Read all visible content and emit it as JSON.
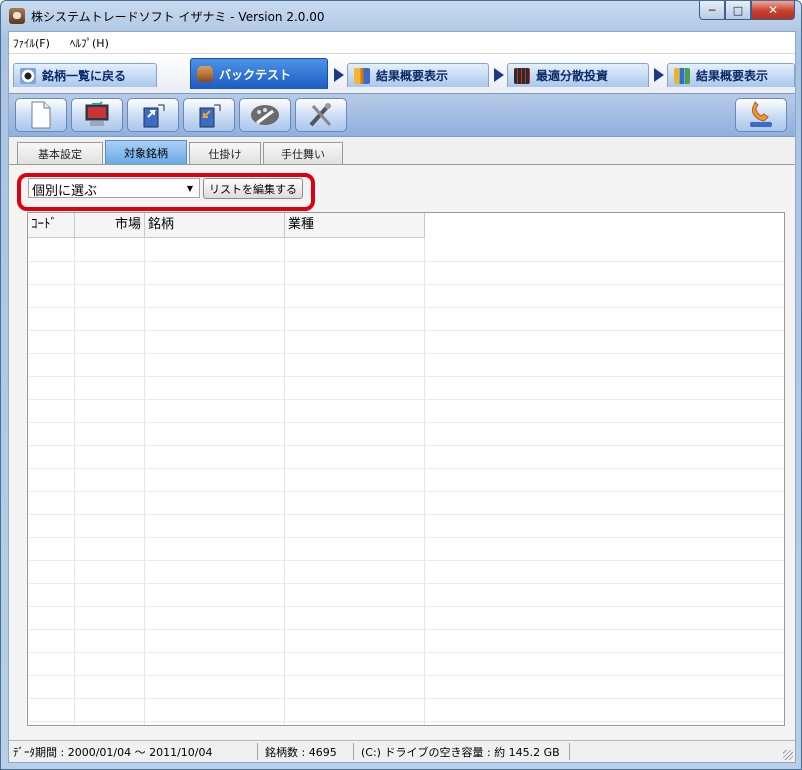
{
  "window": {
    "title": "株システムトレードソフト イザナミ - Version 2.0.00",
    "caption_buttons": [
      "minimize-icon",
      "maximize-icon",
      "close-icon"
    ]
  },
  "menubar": {
    "file": "ﾌｧｲﾙ(F)",
    "help": "ﾍﾙﾌﾟ(H)"
  },
  "main_tabs": [
    {
      "label": "銘柄一覧に戻る",
      "icon": "eye-icon"
    },
    {
      "label": "バックテスト",
      "icon": "bag-icon"
    },
    {
      "label": "結果概要表示",
      "icon": "results-icon"
    },
    {
      "label": "最適分散投資",
      "icon": "grid-chart-icon"
    },
    {
      "label": "結果概要表示",
      "icon": "bar-chart-icon"
    }
  ],
  "toolbar": {
    "buttons": [
      "new-file-icon",
      "computer-icon",
      "export-icon",
      "import-icon",
      "wrench-palette-icon",
      "tools-icon",
      "phone-support-icon"
    ]
  },
  "sub_tabs": [
    {
      "label": "基本設定"
    },
    {
      "label": "対象銘柄"
    },
    {
      "label": "仕掛け"
    },
    {
      "label": "手仕舞い"
    }
  ],
  "selection": {
    "combo_value": "個別に選ぶ",
    "edit_button": "リストを編集する"
  },
  "grid": {
    "columns": [
      "ｺｰﾄﾞ",
      "市場",
      "銘柄",
      "業種"
    ],
    "rows": []
  },
  "statusbar": {
    "data_period": "ﾃﾞｰﾀ期間 : 2000/01/04 ～ 2011/10/04",
    "stock_count": "銘柄数 : 4695",
    "disk_free": "(C:) ドライブの空き容量 : 約 145.2 GB"
  },
  "colors": {
    "active_tab": "#1a5bc4",
    "highlight_border": "#e0000d",
    "selected_subtab": "#6aa9e6"
  }
}
